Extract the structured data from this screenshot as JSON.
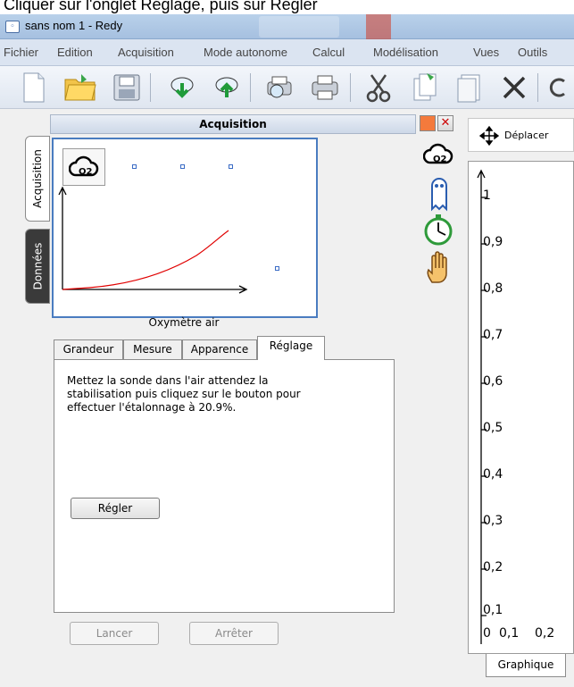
{
  "instruction": "Cliquer sur l'onglet Réglage, puis sur Régler",
  "window": {
    "title": "sans nom 1 - Redy"
  },
  "menu": {
    "items": [
      "Fichier",
      "Edition",
      "Acquisition",
      "Mode autonome",
      "Calcul",
      "Modélisation",
      "Vues",
      "Outils"
    ]
  },
  "toolbar": {
    "buttons": [
      "new-document",
      "open-folder",
      "save",
      "download",
      "upload",
      "print-preview",
      "print",
      "cut",
      "copy",
      "paste",
      "delete",
      "undo"
    ]
  },
  "side_tabs": {
    "acquisition": "Acquisition",
    "donnees": "Données"
  },
  "acquisition_panel": {
    "title": "Acquisition",
    "sensor_name": "Oxymètre air",
    "sensor_icon_label": "O2",
    "tabs": [
      "Grandeur",
      "Mesure",
      "Apparence",
      "Réglage"
    ],
    "active_tab": "Réglage",
    "message": "Mettez la sonde dans l'air attendez la stabilisation puis cliquez sur le bouton pour effectuer l'étalonnage à 20.9%.",
    "regler_label": "Régler",
    "lancer_label": "Lancer",
    "arreter_label": "Arrêter"
  },
  "graph_panel": {
    "move_label": "Déplacer",
    "tab_label": "Graphique",
    "y_ticks": [
      "1",
      "0,9",
      "0,8",
      "0,7",
      "0,6",
      "0,5",
      "0,4",
      "0,3",
      "0,2",
      "0,1"
    ],
    "x_ticks": [
      "0",
      "0,1",
      "0,2"
    ]
  },
  "colors": {
    "accent": "#4a7cc0",
    "curve": "#e00000",
    "orange": "#f47a3c",
    "close_red": "#d9302a"
  }
}
